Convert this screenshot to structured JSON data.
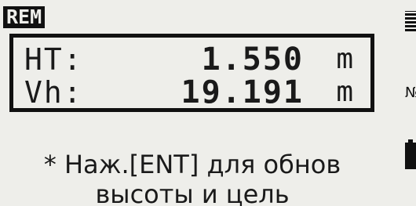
{
  "screen": {
    "mode_label": "REM",
    "readings": [
      {
        "label": "HT:",
        "value": "1.550",
        "unit": "m"
      },
      {
        "label": "Vh:",
        "value": "19.191",
        "unit": "m"
      }
    ],
    "hint_line1": "* Наж.[ENT] для обнов",
    "hint_line2": "высоты и цель"
  },
  "status": {
    "tilt_text": "№"
  },
  "colors": {
    "background": "#eeeeea",
    "foreground": "#111111"
  },
  "icons": [
    "signal-icon",
    "tilt-icon",
    "battery-icon"
  ]
}
